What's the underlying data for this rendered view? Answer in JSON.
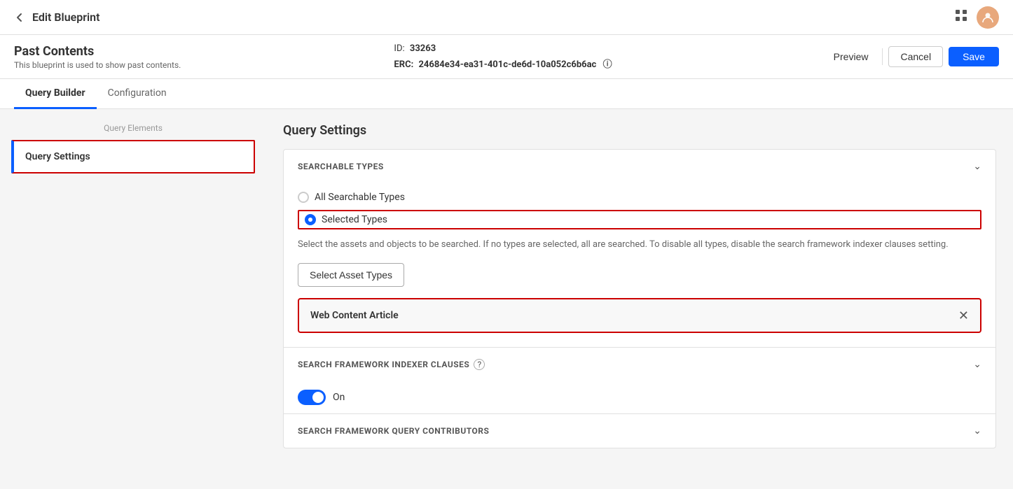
{
  "topNav": {
    "backIcon": "←",
    "pageTitle": "Edit Blueprint",
    "gridIconLabel": "grid-icon",
    "avatarLabel": "user-avatar"
  },
  "header": {
    "blueprintTitle": "Past Contents",
    "subtitle": "This blueprint is used to show past contents.",
    "idLabel": "ID:",
    "idValue": "33263",
    "ercLabel": "ERC:",
    "ercValue": "24684e34-ea31-401c-de6d-10a052c6b6ac",
    "previewBtn": "Preview",
    "cancelBtn": "Cancel",
    "saveBtn": "Save"
  },
  "tabs": [
    {
      "label": "Query Builder",
      "active": true
    },
    {
      "label": "Configuration",
      "active": false
    }
  ],
  "sidebar": {
    "sectionLabel": "Query Elements",
    "items": [
      {
        "label": "Query Settings",
        "active": true
      }
    ]
  },
  "querySettings": {
    "sectionTitle": "Query Settings",
    "searchableTypes": {
      "label": "SEARCHABLE TYPES",
      "options": [
        {
          "label": "All Searchable Types",
          "selected": false
        },
        {
          "label": "Selected Types",
          "selected": true
        }
      ],
      "helpText": "Select the assets and objects to be searched. If no types are selected, all are searched. To disable all types, disable the search framework indexer clauses setting.",
      "selectAssetTypesBtn": "Select Asset Types",
      "selectedAsset": "Web Content Article"
    },
    "searchFrameworkIndexer": {
      "label": "SEARCH FRAMEWORK INDEXER CLAUSES",
      "toggleLabel": "On"
    },
    "searchFrameworkQuery": {
      "label": "SEARCH FRAMEWORK QUERY CONTRIBUTORS"
    }
  }
}
